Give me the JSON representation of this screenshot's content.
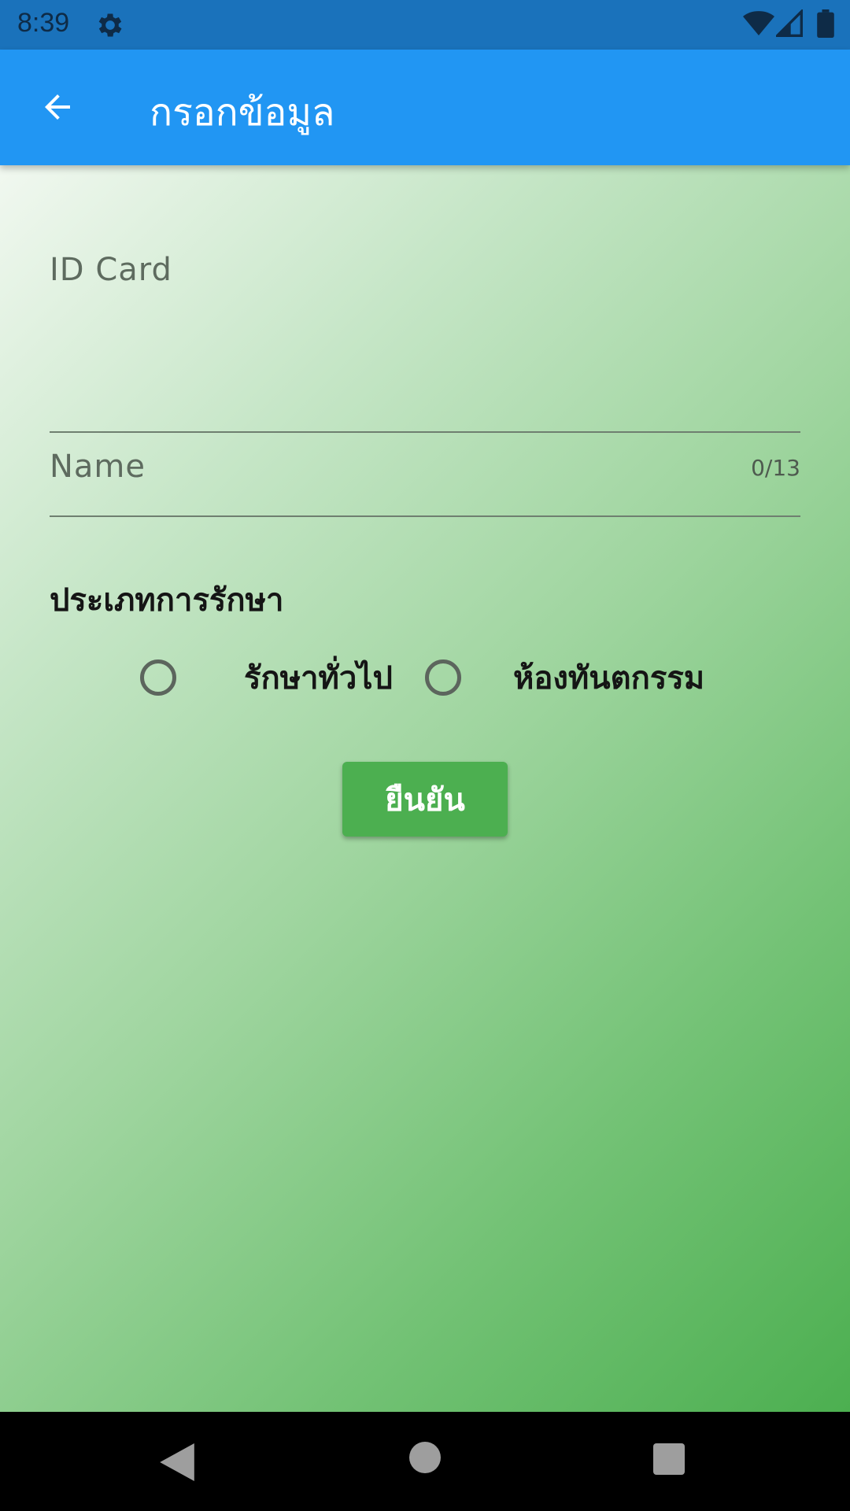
{
  "status_bar": {
    "time": "8:39",
    "icons": [
      "gear-icon",
      "wifi-icon",
      "signal-icon",
      "battery-icon"
    ]
  },
  "app_bar": {
    "title": "กรอกข้อมูล",
    "back_icon": "arrow-left-icon",
    "color": "#2196f3"
  },
  "form": {
    "id_card": {
      "label": "ID Card",
      "value": "",
      "counter": "0/13"
    },
    "name": {
      "label": "Name",
      "value": ""
    },
    "treatment_type": {
      "title": "ประเภทการรักษา",
      "options": [
        {
          "label": "รักษาทั่วไป",
          "selected": false
        },
        {
          "label": "ห้องทันตกรรม",
          "selected": false
        }
      ]
    },
    "confirm_label": "ยืนยัน",
    "confirm_color": "#4caf50"
  },
  "nav_bar": {
    "icons": [
      "back-triangle-icon",
      "home-circle-icon",
      "recents-square-icon"
    ]
  }
}
